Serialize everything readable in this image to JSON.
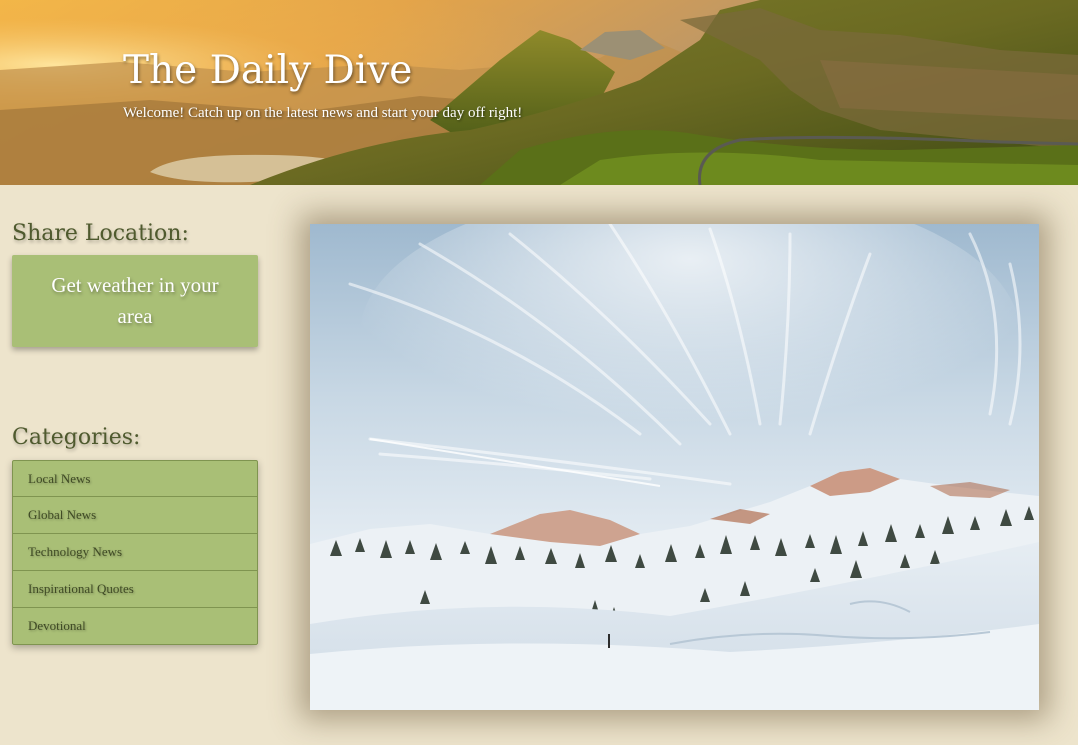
{
  "header": {
    "title": "The Daily Dive",
    "tagline": "Welcome! Catch up on the latest news and start your day off right!",
    "banner_image": "highland-mountain-sunrise-landscape"
  },
  "sidebar": {
    "location_heading": "Share Location:",
    "weather_button_label": "Get weather in your area",
    "categories_heading": "Categories:",
    "categories": [
      {
        "label": "Local News"
      },
      {
        "label": "Global News"
      },
      {
        "label": "Technology News"
      },
      {
        "label": "Inspirational Quotes"
      },
      {
        "label": "Devotional"
      }
    ]
  },
  "main": {
    "feature_image": "snowy-mountain-winter-landscape"
  },
  "colors": {
    "page_background": "#ede4cc",
    "button_green": "#a9bf76",
    "heading_olive": "#4f5a2e",
    "header_text": "#ffffff"
  }
}
